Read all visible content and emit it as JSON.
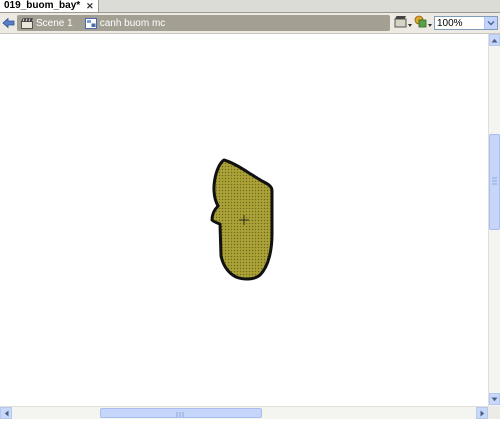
{
  "tab": {
    "title": "019_buom_bay*",
    "close": "✕"
  },
  "editbar": {
    "breadcrumbs": [
      {
        "label": "Scene 1",
        "icon": "clapperboard-icon"
      },
      {
        "label": "canh buom mc",
        "icon": "movieclip-symbol-icon"
      }
    ],
    "edit_scene_icon": "edit-scene-icon",
    "edit_symbols_icon": "edit-symbols-icon",
    "zoom": "100%"
  },
  "colors": {
    "shape_fill": "#a39a32",
    "shape_stroke": "#111111",
    "crumb_bar": "#a39f93",
    "scroll_thumb": "#c6d6fb"
  }
}
